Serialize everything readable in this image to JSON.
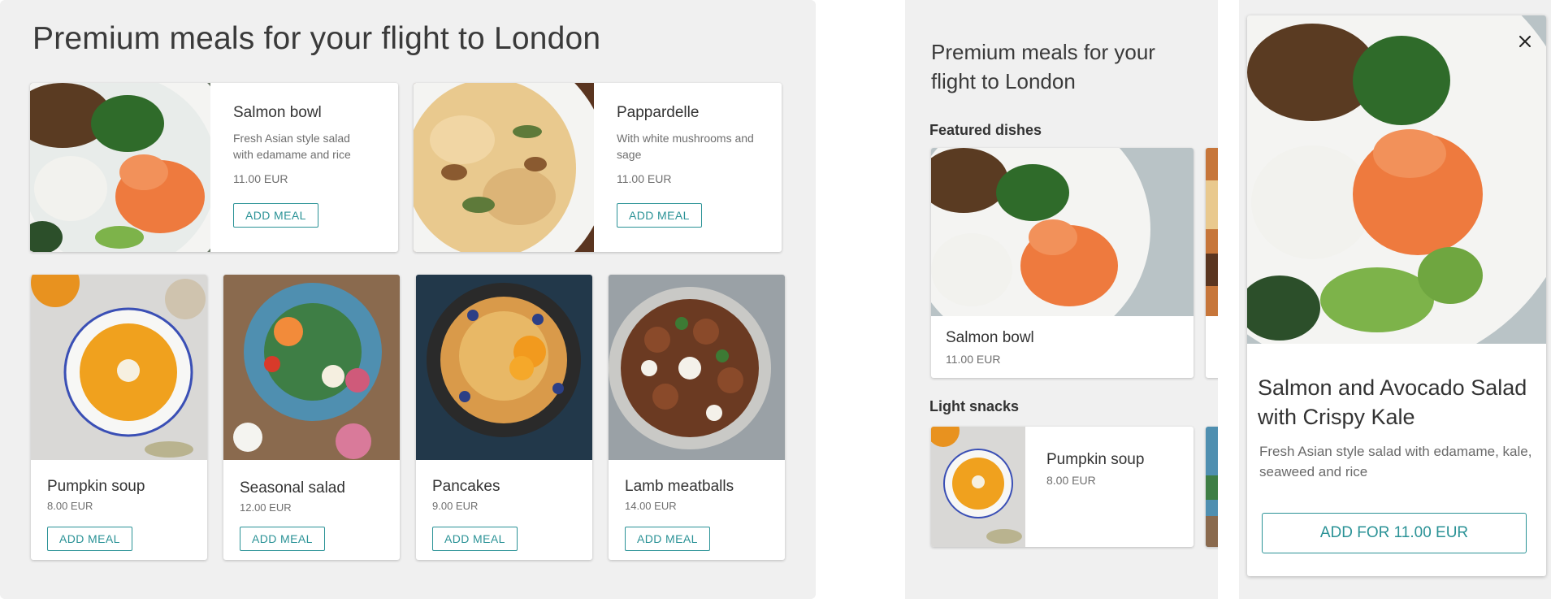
{
  "desktop": {
    "title": "Premium meals for your flight to London",
    "featured": [
      {
        "name": "Salmon bowl",
        "desc": "Fresh Asian style salad with edamame and rice",
        "price": "11.00 EUR",
        "button": "ADD MEAL"
      },
      {
        "name": "Pappardelle",
        "desc": "With white mushrooms and sage",
        "price": "11.00 EUR",
        "button": "ADD MEAL"
      }
    ],
    "grid": [
      {
        "name": "Pumpkin soup",
        "price": "8.00 EUR",
        "button": "ADD MEAL"
      },
      {
        "name": "Seasonal salad",
        "price": "12.00 EUR",
        "button": "ADD MEAL"
      },
      {
        "name": "Pancakes",
        "price": "9.00 EUR",
        "button": "ADD MEAL"
      },
      {
        "name": "Lamb meatballs",
        "price": "14.00 EUR",
        "button": "ADD MEAL"
      }
    ]
  },
  "mobile": {
    "title": "Premium meals for your flight to London",
    "featured_heading": "Featured dishes",
    "featured_card": {
      "name": "Salmon bowl",
      "price": "11.00 EUR"
    },
    "snacks_heading": "Light snacks",
    "snack_card": {
      "name": "Pumpkin soup",
      "price": "8.00 EUR"
    }
  },
  "detail": {
    "name": "Salmon and Avocado Salad with Crispy Kale",
    "desc": "Fresh Asian style salad with edamame, kale, seaweed and rice",
    "button": "ADD FOR 11.00 EUR",
    "close_icon": "close-icon"
  },
  "colors": {
    "accent": "#2a9296",
    "panel_bg": "#f0f0f0"
  }
}
